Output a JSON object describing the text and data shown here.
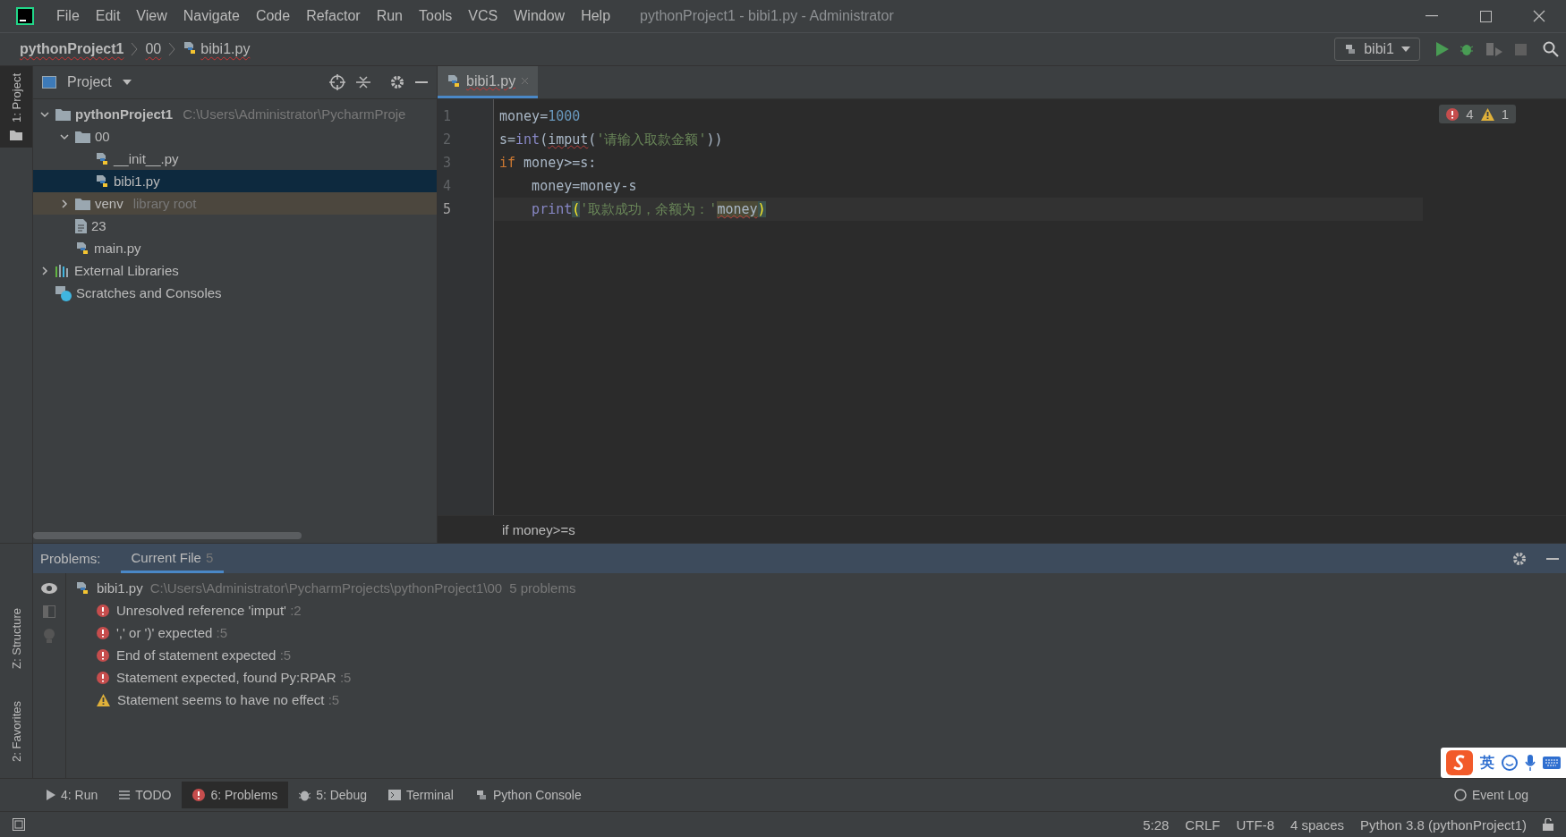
{
  "window": {
    "title": "pythonProject1 - bibi1.py - Administrator"
  },
  "menu": [
    "File",
    "Edit",
    "View",
    "Navigate",
    "Code",
    "Refactor",
    "Run",
    "Tools",
    "VCS",
    "Window",
    "Help"
  ],
  "breadcrumbs": [
    "pythonProject1",
    "00",
    "bibi1.py"
  ],
  "run_config": {
    "label": "bibi1"
  },
  "side_tabs_top": [
    {
      "label": "1: Project",
      "selected": true
    }
  ],
  "side_tabs_bottom": [
    {
      "label": "Z: Structure",
      "selected": false
    },
    {
      "label": "2: Favorites",
      "selected": false
    }
  ],
  "project_panel": {
    "title": "Project",
    "tree": [
      {
        "label": "pythonProject1",
        "kind": "folder",
        "bold": true,
        "hint": "C:\\Users\\Administrator\\PycharmProje",
        "expanded": true,
        "selected": false,
        "children": [
          {
            "label": "00",
            "kind": "folder",
            "expanded": true,
            "selected": false,
            "children": [
              {
                "label": "__init__.py",
                "kind": "python",
                "selected": false
              },
              {
                "label": "bibi1.py",
                "kind": "python",
                "selected": true
              }
            ]
          },
          {
            "label": "venv",
            "kind": "folder",
            "hint": "library root",
            "library": true,
            "expanded": false,
            "selected": false
          },
          {
            "label": "23",
            "kind": "text",
            "selected": false
          },
          {
            "label": "main.py",
            "kind": "python",
            "selected": false
          }
        ]
      },
      {
        "label": "External Libraries",
        "kind": "libraries",
        "expanded": false,
        "selected": false
      },
      {
        "label": "Scratches and Consoles",
        "kind": "scratches",
        "selected": false
      }
    ]
  },
  "editor": {
    "tabs": [
      {
        "label": "bibi1.py",
        "selected": true
      }
    ],
    "inspections": {
      "errors": "4",
      "warnings": "1"
    },
    "lines": [
      {
        "number": "1",
        "current": false,
        "tokens": [
          {
            "text": "money=",
            "kind": "plain"
          },
          {
            "text": "1000",
            "kind": "number"
          }
        ]
      },
      {
        "number": "2",
        "current": false,
        "tokens": [
          {
            "text": "s=",
            "kind": "plain"
          },
          {
            "text": "int",
            "kind": "builtin"
          },
          {
            "text": "(",
            "kind": "plain"
          },
          {
            "text": "imput",
            "kind": "error"
          },
          {
            "text": "('请输入取款金额'))",
            "kind": "plain_string"
          }
        ]
      },
      {
        "number": "3",
        "current": false,
        "tokens": [
          {
            "text": "if",
            "kind": "keyword"
          },
          {
            "text": " money>=s:",
            "kind": "plain"
          }
        ]
      },
      {
        "number": "4",
        "current": false,
        "tokens": [
          {
            "text": "    money=money-s",
            "kind": "plain"
          }
        ]
      },
      {
        "number": "5",
        "current": true,
        "tokens": [
          {
            "text": "    print",
            "kind": "builtin"
          },
          {
            "text": "(",
            "kind": "brace"
          },
          {
            "text": "'取款成功，余额为：'",
            "kind": "string"
          },
          {
            "text": "money",
            "kind": "error_highlight"
          },
          {
            "text": ")",
            "kind": "brace"
          }
        ]
      }
    ],
    "breadcrumb": "if money>=s"
  },
  "problems": {
    "label": "Problems:",
    "tabs": [
      {
        "label": "Current File",
        "count": "5",
        "selected": true
      }
    ],
    "file": {
      "name": "bibi1.py",
      "path": "C:\\Users\\Administrator\\PycharmProjects\\pythonProject1\\00",
      "summary": "5 problems"
    },
    "items": [
      {
        "kind": "error",
        "text": "Unresolved reference 'imput'",
        "location": ":2"
      },
      {
        "kind": "error",
        "text": "',' or ')' expected",
        "location": ":5"
      },
      {
        "kind": "error",
        "text": "End of statement expected",
        "location": ":5"
      },
      {
        "kind": "error",
        "text": "Statement expected, found Py:RPAR",
        "location": ":5"
      },
      {
        "kind": "warning",
        "text": "Statement seems to have no effect",
        "location": ":5"
      }
    ]
  },
  "tool_windows": [
    {
      "label": "4: Run",
      "kind": "run",
      "selected": false
    },
    {
      "label": "TODO",
      "kind": "todo",
      "selected": false
    },
    {
      "label": "6: Problems",
      "kind": "problems",
      "selected": true
    },
    {
      "label": "5: Debug",
      "kind": "debug",
      "selected": false
    },
    {
      "label": "Terminal",
      "kind": "terminal",
      "selected": false
    },
    {
      "label": "Python Console",
      "kind": "python",
      "selected": false
    }
  ],
  "event_log": "Event Log",
  "ime": {
    "label": "英"
  },
  "status_bar": [
    "5:28",
    "CRLF",
    "UTF-8",
    "4 spaces",
    "Python 3.8 (pythonProject1)"
  ]
}
